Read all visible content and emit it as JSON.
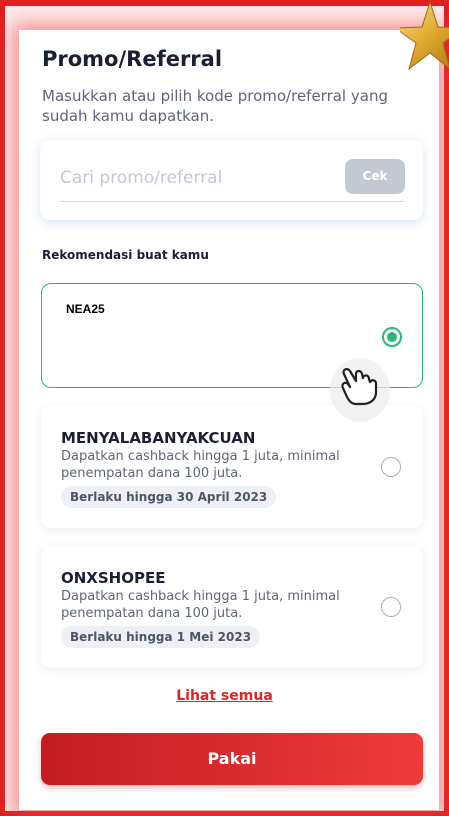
{
  "promo": {
    "title": "Promo/Referral",
    "subtitle": "Masukkan atau pilih kode promo/referral yang sudah kamu dapatkan.",
    "search": {
      "placeholder": "Cari promo/referral",
      "value": "",
      "check_label": "Cek"
    },
    "recommend_label": "Rekomendasi buat kamu",
    "items": [
      {
        "code": "NEA25",
        "selected": true
      },
      {
        "code": "MENYALABANYAKCUAN",
        "description": "Dapatkan cashback hingga 1 juta, minimal penempatan dana 100 juta.",
        "validity": "Berlaku hingga 30 April 2023",
        "selected": false
      },
      {
        "code": "ONXSHOPEE",
        "description": "Dapatkan cashback hingga 1 juta, minimal penempatan dana 100 juta.",
        "validity": "Berlaku hingga 1 Mei 2023",
        "selected": false
      }
    ],
    "see_all_label": "Lihat semua",
    "apply_label": "Pakai"
  },
  "colors": {
    "accent_red": "#e02020",
    "selected_green": "#2bb673",
    "button_disabled": "#c3c8d1"
  },
  "icons": {
    "decoration": "star-icon",
    "pointer": "hand-pointer-icon"
  }
}
